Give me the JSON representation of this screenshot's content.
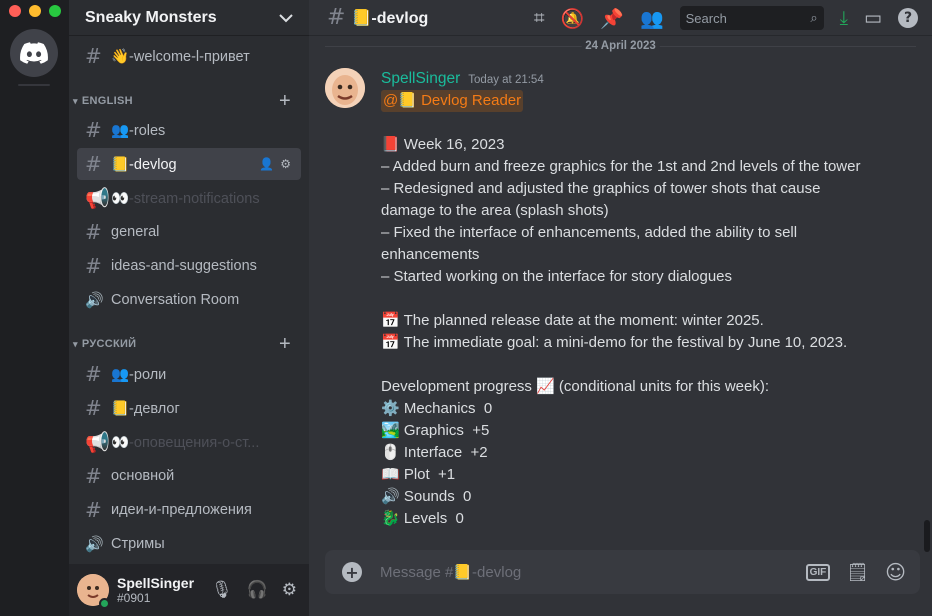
{
  "server": {
    "name": "Sneaky Monsters"
  },
  "sidebar": {
    "top_channel": {
      "icon": "hash",
      "label": "👋-welcome-l-привет"
    },
    "categories": [
      {
        "label": "ENGLISH"
      },
      {
        "label": "РУССКИЙ"
      }
    ],
    "english": [
      {
        "icon": "hash",
        "label": "👥-roles",
        "state": "normal"
      },
      {
        "icon": "hash",
        "label": "📒-devlog",
        "state": "active"
      },
      {
        "icon": "megaphone",
        "label": "👀-stream-notifications",
        "state": "muted"
      },
      {
        "icon": "hash",
        "label": "general",
        "state": "normal"
      },
      {
        "icon": "hash",
        "label": "ideas-and-suggestions",
        "state": "normal"
      },
      {
        "icon": "speaker",
        "label": "Conversation Room",
        "state": "normal"
      }
    ],
    "russian": [
      {
        "icon": "hash",
        "label": "👥-роли",
        "state": "normal"
      },
      {
        "icon": "hash",
        "label": "📒-девлог",
        "state": "normal"
      },
      {
        "icon": "megaphone",
        "label": "👀-оповещения-о-ст...",
        "state": "muted"
      },
      {
        "icon": "hash",
        "label": "основной",
        "state": "normal"
      },
      {
        "icon": "hash",
        "label": "идеи-и-предложения",
        "state": "normal"
      },
      {
        "icon": "speaker",
        "label": "Стримы",
        "state": "normal"
      }
    ]
  },
  "user": {
    "name": "SpellSinger",
    "tag": "#0901",
    "status": "online"
  },
  "chat": {
    "channel": "📒-devlog",
    "search_placeholder": "Search",
    "date_divider": "24 April 2023",
    "message": {
      "author": "SpellSinger",
      "timestamp": "Today at 21:54",
      "mention": "@📒 Devlog Reader",
      "lines": [
        "",
        "📕 Week 16, 2023",
        "– Added burn and freeze graphics for the 1st and 2nd levels of the tower",
        "– Redesigned and adjusted the graphics of tower shots that cause",
        "damage to the area (splash shots)",
        "– Fixed the interface of enhancements, added the ability to sell",
        "enhancements",
        "– Started working on the interface for story dialogues",
        "",
        "📅 The planned release date at the moment: winter 2025.",
        "📅 The immediate goal: a mini-demo for the festival by June 10, 2023.",
        "",
        "Development progress 📈 (conditional units for this week):",
        "⚙️ Mechanics  0",
        "🏞️ Graphics  +5",
        "🖱️ Interface  +2",
        "📖 Plot  +1",
        "🔊 Sounds  0",
        "🐉 Levels  0"
      ]
    },
    "composer_placeholder": "Message #📒-devlog",
    "gif_label": "GIF"
  },
  "colors": {
    "accent_author": "#1abc9c",
    "mention": "#f47b16",
    "bg_chat": "#313338",
    "bg_sidebar": "#2b2d31",
    "bg_rail": "#1e1f22"
  }
}
